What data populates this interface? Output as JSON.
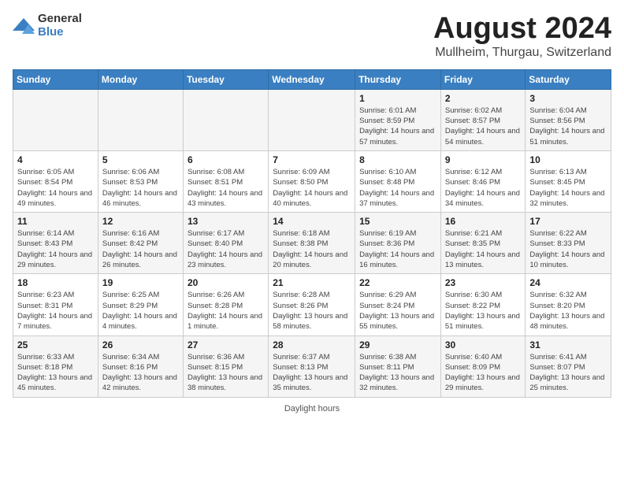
{
  "header": {
    "logo_general": "General",
    "logo_blue": "Blue",
    "month_title": "August 2024",
    "location": "Mullheim, Thurgau, Switzerland"
  },
  "days_of_week": [
    "Sunday",
    "Monday",
    "Tuesday",
    "Wednesday",
    "Thursday",
    "Friday",
    "Saturday"
  ],
  "weeks": [
    [
      {
        "day": "",
        "info": ""
      },
      {
        "day": "",
        "info": ""
      },
      {
        "day": "",
        "info": ""
      },
      {
        "day": "",
        "info": ""
      },
      {
        "day": "1",
        "info": "Sunrise: 6:01 AM\nSunset: 8:59 PM\nDaylight: 14 hours and 57 minutes."
      },
      {
        "day": "2",
        "info": "Sunrise: 6:02 AM\nSunset: 8:57 PM\nDaylight: 14 hours and 54 minutes."
      },
      {
        "day": "3",
        "info": "Sunrise: 6:04 AM\nSunset: 8:56 PM\nDaylight: 14 hours and 51 minutes."
      }
    ],
    [
      {
        "day": "4",
        "info": "Sunrise: 6:05 AM\nSunset: 8:54 PM\nDaylight: 14 hours and 49 minutes."
      },
      {
        "day": "5",
        "info": "Sunrise: 6:06 AM\nSunset: 8:53 PM\nDaylight: 14 hours and 46 minutes."
      },
      {
        "day": "6",
        "info": "Sunrise: 6:08 AM\nSunset: 8:51 PM\nDaylight: 14 hours and 43 minutes."
      },
      {
        "day": "7",
        "info": "Sunrise: 6:09 AM\nSunset: 8:50 PM\nDaylight: 14 hours and 40 minutes."
      },
      {
        "day": "8",
        "info": "Sunrise: 6:10 AM\nSunset: 8:48 PM\nDaylight: 14 hours and 37 minutes."
      },
      {
        "day": "9",
        "info": "Sunrise: 6:12 AM\nSunset: 8:46 PM\nDaylight: 14 hours and 34 minutes."
      },
      {
        "day": "10",
        "info": "Sunrise: 6:13 AM\nSunset: 8:45 PM\nDaylight: 14 hours and 32 minutes."
      }
    ],
    [
      {
        "day": "11",
        "info": "Sunrise: 6:14 AM\nSunset: 8:43 PM\nDaylight: 14 hours and 29 minutes."
      },
      {
        "day": "12",
        "info": "Sunrise: 6:16 AM\nSunset: 8:42 PM\nDaylight: 14 hours and 26 minutes."
      },
      {
        "day": "13",
        "info": "Sunrise: 6:17 AM\nSunset: 8:40 PM\nDaylight: 14 hours and 23 minutes."
      },
      {
        "day": "14",
        "info": "Sunrise: 6:18 AM\nSunset: 8:38 PM\nDaylight: 14 hours and 20 minutes."
      },
      {
        "day": "15",
        "info": "Sunrise: 6:19 AM\nSunset: 8:36 PM\nDaylight: 14 hours and 16 minutes."
      },
      {
        "day": "16",
        "info": "Sunrise: 6:21 AM\nSunset: 8:35 PM\nDaylight: 14 hours and 13 minutes."
      },
      {
        "day": "17",
        "info": "Sunrise: 6:22 AM\nSunset: 8:33 PM\nDaylight: 14 hours and 10 minutes."
      }
    ],
    [
      {
        "day": "18",
        "info": "Sunrise: 6:23 AM\nSunset: 8:31 PM\nDaylight: 14 hours and 7 minutes."
      },
      {
        "day": "19",
        "info": "Sunrise: 6:25 AM\nSunset: 8:29 PM\nDaylight: 14 hours and 4 minutes."
      },
      {
        "day": "20",
        "info": "Sunrise: 6:26 AM\nSunset: 8:28 PM\nDaylight: 14 hours and 1 minute."
      },
      {
        "day": "21",
        "info": "Sunrise: 6:28 AM\nSunset: 8:26 PM\nDaylight: 13 hours and 58 minutes."
      },
      {
        "day": "22",
        "info": "Sunrise: 6:29 AM\nSunset: 8:24 PM\nDaylight: 13 hours and 55 minutes."
      },
      {
        "day": "23",
        "info": "Sunrise: 6:30 AM\nSunset: 8:22 PM\nDaylight: 13 hours and 51 minutes."
      },
      {
        "day": "24",
        "info": "Sunrise: 6:32 AM\nSunset: 8:20 PM\nDaylight: 13 hours and 48 minutes."
      }
    ],
    [
      {
        "day": "25",
        "info": "Sunrise: 6:33 AM\nSunset: 8:18 PM\nDaylight: 13 hours and 45 minutes."
      },
      {
        "day": "26",
        "info": "Sunrise: 6:34 AM\nSunset: 8:16 PM\nDaylight: 13 hours and 42 minutes."
      },
      {
        "day": "27",
        "info": "Sunrise: 6:36 AM\nSunset: 8:15 PM\nDaylight: 13 hours and 38 minutes."
      },
      {
        "day": "28",
        "info": "Sunrise: 6:37 AM\nSunset: 8:13 PM\nDaylight: 13 hours and 35 minutes."
      },
      {
        "day": "29",
        "info": "Sunrise: 6:38 AM\nSunset: 8:11 PM\nDaylight: 13 hours and 32 minutes."
      },
      {
        "day": "30",
        "info": "Sunrise: 6:40 AM\nSunset: 8:09 PM\nDaylight: 13 hours and 29 minutes."
      },
      {
        "day": "31",
        "info": "Sunrise: 6:41 AM\nSunset: 8:07 PM\nDaylight: 13 hours and 25 minutes."
      }
    ]
  ],
  "footer": {
    "note": "Daylight hours"
  }
}
